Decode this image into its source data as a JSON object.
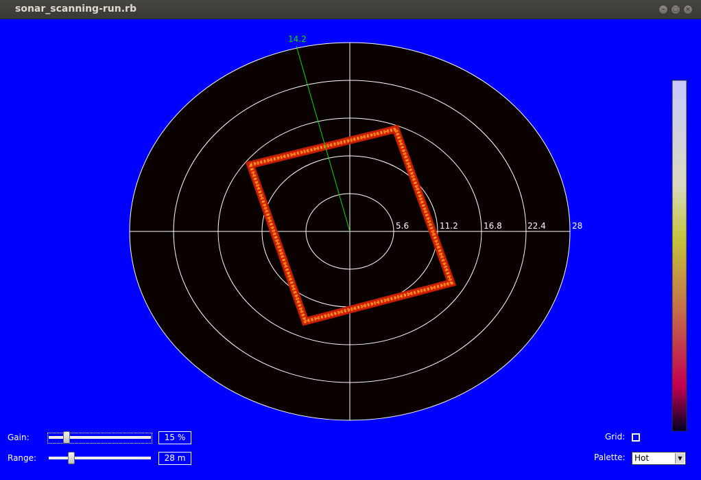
{
  "window": {
    "title": "sonar_scanning-run.rb"
  },
  "sonar": {
    "ring_labels": [
      "5.6",
      "11.2",
      "16.8",
      "22.4",
      "28"
    ],
    "beam_label": "14.2",
    "beam_color": "#00e000",
    "background_color": "#0000ff",
    "display_color": "#0a0000"
  },
  "controls": {
    "gain_label": "Gain:",
    "gain_value": "15 %",
    "gain_fraction": 0.15,
    "range_label": "Range:",
    "range_value": "28 m",
    "range_fraction": 0.2,
    "grid_label": "Grid:",
    "grid_checked": false,
    "palette_label": "Palette:",
    "palette_value": "Hot"
  },
  "colorbar": {
    "palette": "Hot",
    "stops": [
      "#c8c8ff",
      "#c4c43c",
      "#c44a3c",
      "#c40050",
      "#000028"
    ]
  }
}
